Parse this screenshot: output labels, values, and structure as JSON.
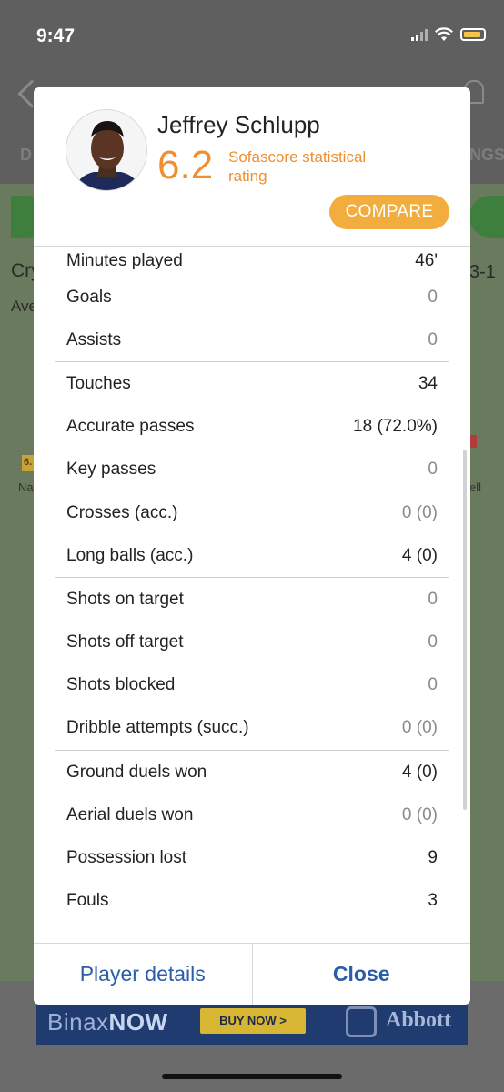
{
  "status_bar": {
    "time": "9:47"
  },
  "background": {
    "tab_left": "D",
    "tab_right": "NGS",
    "team_left": "Cry",
    "team_left_sub": "Ave",
    "score_right": "3-1",
    "rating_left": "6.",
    "player_left": "Na",
    "player_right": "ell"
  },
  "dialog": {
    "player_name": "Jeffrey Schlupp",
    "rating": "6.2",
    "rating_label": "Sofascore statistical rating",
    "compare_label": "COMPARE",
    "stat_groups": [
      {
        "rows": [
          {
            "label": "Minutes played",
            "value": "46'"
          },
          {
            "label": "Goals",
            "value": "0"
          },
          {
            "label": "Assists",
            "value": "0"
          }
        ]
      },
      {
        "rows": [
          {
            "label": "Touches",
            "value": "34"
          },
          {
            "label": "Accurate passes",
            "value": "18 (72.0%)"
          },
          {
            "label": "Key passes",
            "value": "0"
          },
          {
            "label": "Crosses (acc.)",
            "value": "0 (0)"
          },
          {
            "label": "Long balls (acc.)",
            "value": "4 (0)"
          }
        ]
      },
      {
        "rows": [
          {
            "label": "Shots on target",
            "value": "0"
          },
          {
            "label": "Shots off target",
            "value": "0"
          },
          {
            "label": "Shots blocked",
            "value": "0"
          },
          {
            "label": "Dribble attempts (succ.)",
            "value": "0 (0)"
          }
        ]
      },
      {
        "rows": [
          {
            "label": "Ground duels won",
            "value": "4 (0)"
          },
          {
            "label": "Aerial duels won",
            "value": "0 (0)"
          },
          {
            "label": "Possession lost",
            "value": "9"
          },
          {
            "label": "Fouls",
            "value": "3"
          }
        ]
      }
    ],
    "footer": {
      "player_details_label": "Player details",
      "close_label": "Close"
    }
  },
  "ad": {
    "brand_light": "Binax",
    "brand_bold": "NOW",
    "button_label": "BUY NOW >",
    "sponsor": "Abbott"
  },
  "colors": {
    "accent_orange": "#ef8f2f",
    "compare_button": "#f2ad3e",
    "link_blue": "#2a5ea8"
  }
}
